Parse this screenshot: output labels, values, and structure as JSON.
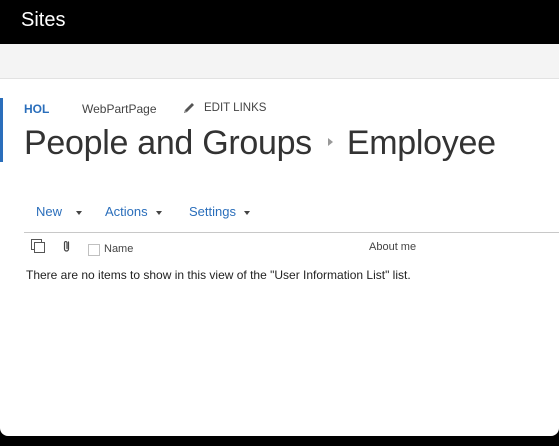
{
  "suite_bar": {
    "title": "Sites"
  },
  "top_nav": {
    "items": [
      "HOL",
      "WebPartPage"
    ],
    "edit_links": "EDIT LINKS"
  },
  "page_title": {
    "parent": "People and Groups",
    "current": "Employee"
  },
  "toolbar": {
    "new_label": "New",
    "actions_label": "Actions",
    "settings_label": "Settings"
  },
  "list": {
    "columns": [
      "Name",
      "About me"
    ],
    "empty_message": "There are no items to show in this view of the \"User Information List\" list."
  },
  "colors": {
    "accent": "#2a6ebb",
    "text": "#333333"
  }
}
